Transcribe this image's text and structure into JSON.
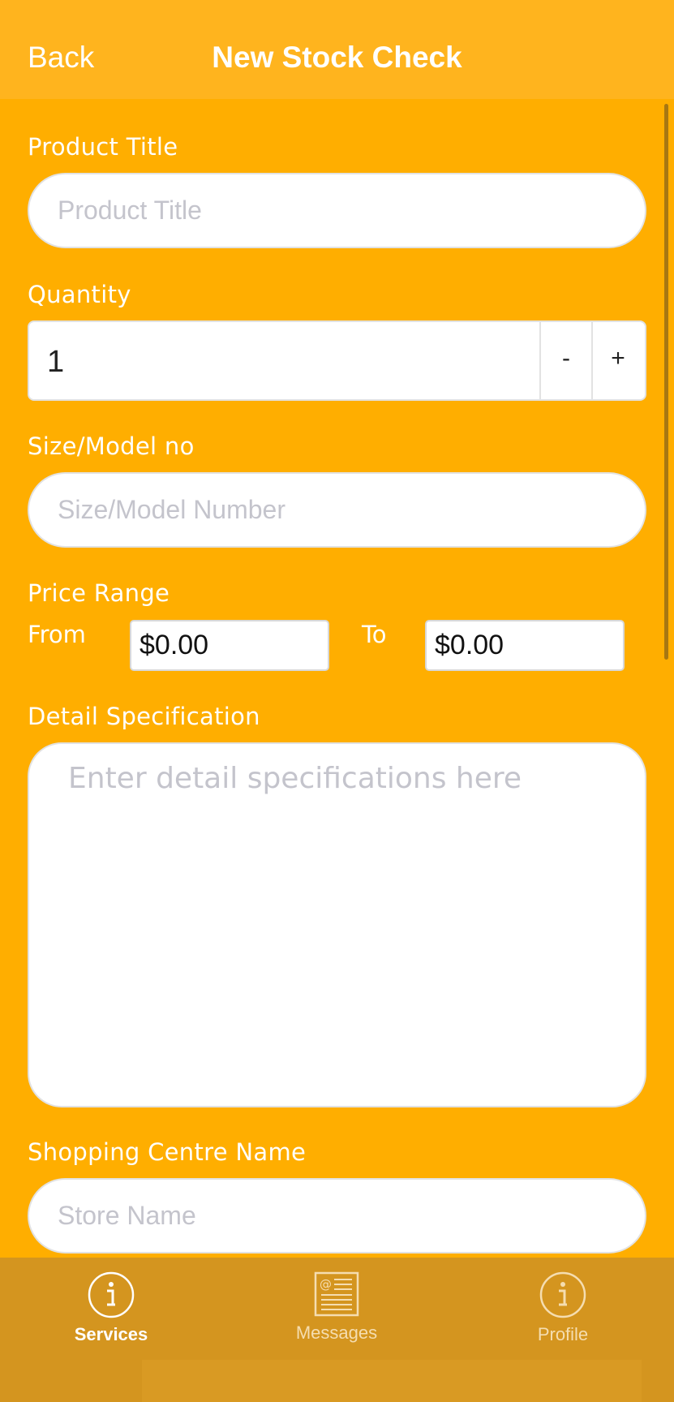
{
  "nav": {
    "back_label": "Back",
    "title": "New Stock Check"
  },
  "form": {
    "product_title": {
      "label": "Product Title",
      "placeholder": "Product Title",
      "value": ""
    },
    "quantity": {
      "label": "Quantity",
      "value": "1",
      "minus_label": "-",
      "plus_label": "+"
    },
    "size_model": {
      "label": "Size/Model no",
      "placeholder": "Size/Model Number",
      "value": ""
    },
    "price_range": {
      "label": "Price Range",
      "from_label": "From",
      "to_label": "To",
      "from_value": "$0.00",
      "to_value": "$0.00"
    },
    "detail_spec": {
      "label": "Detail Specification",
      "placeholder": "Enter detail specifications here",
      "value": ""
    },
    "shopping_centre": {
      "label": "Shopping Centre Name",
      "placeholder": "Store Name",
      "value": ""
    }
  },
  "tabbar": {
    "tabs": [
      {
        "label": "Services",
        "icon": "info-circle-icon",
        "active": true
      },
      {
        "label": "Messages",
        "icon": "newspaper-icon",
        "active": false
      },
      {
        "label": "Profile",
        "icon": "info-circle-icon",
        "active": false
      }
    ]
  },
  "colors": {
    "background": "#FFAE00",
    "nav_bar": "#FFB41E",
    "tab_bar": "#D4951F",
    "text_on_accent": "#FFFFFF",
    "placeholder": "#C4C4CC"
  }
}
